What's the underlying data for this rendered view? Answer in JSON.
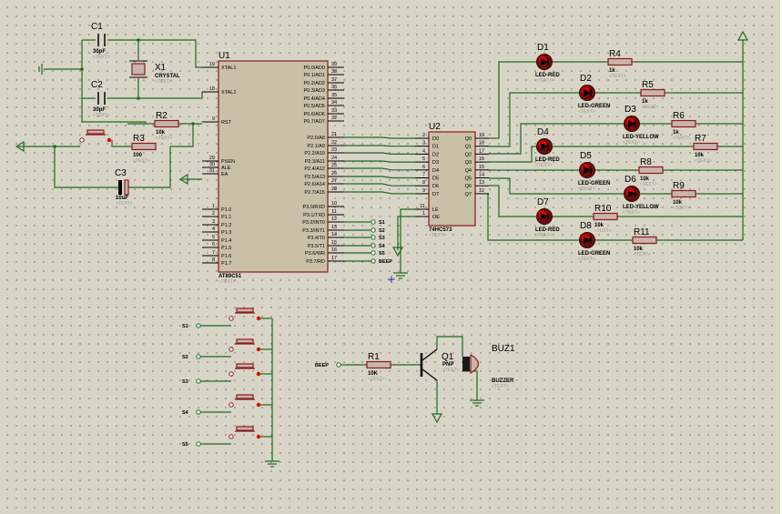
{
  "placeholder": "<TEXT>",
  "u1": {
    "ref": "U1",
    "part": "AT89C51",
    "left_pins": [
      {
        "num": "19",
        "name": "XTAL1"
      },
      {
        "num": "18",
        "name": "XTAL2"
      },
      {
        "num": "9",
        "name": "RST"
      },
      {
        "num": "29",
        "name": "PSEN"
      },
      {
        "num": "30",
        "name": "ALE"
      },
      {
        "num": "31",
        "name": "EA"
      },
      {
        "num": "1",
        "name": "P1.0"
      },
      {
        "num": "2",
        "name": "P1.1"
      },
      {
        "num": "3",
        "name": "P1.2"
      },
      {
        "num": "4",
        "name": "P1.3"
      },
      {
        "num": "5",
        "name": "P1.4"
      },
      {
        "num": "6",
        "name": "P1.5"
      },
      {
        "num": "7",
        "name": "P1.6"
      },
      {
        "num": "8",
        "name": "P1.7"
      }
    ],
    "right_pins": [
      {
        "num": "39",
        "name": "P0.0/AD0"
      },
      {
        "num": "38",
        "name": "P0.1/AD1"
      },
      {
        "num": "37",
        "name": "P0.2/AD2"
      },
      {
        "num": "36",
        "name": "P0.3/AD3"
      },
      {
        "num": "35",
        "name": "P0.4/AD4"
      },
      {
        "num": "34",
        "name": "P0.5/AD5"
      },
      {
        "num": "33",
        "name": "P0.6/AD6"
      },
      {
        "num": "32",
        "name": "P0.7/AD7"
      },
      {
        "num": "21",
        "name": "P2.0/A8"
      },
      {
        "num": "22",
        "name": "P2.1/A9"
      },
      {
        "num": "23",
        "name": "P2.2/A10"
      },
      {
        "num": "24",
        "name": "P2.3/A11"
      },
      {
        "num": "25",
        "name": "P2.4/A12"
      },
      {
        "num": "26",
        "name": "P2.5/A13"
      },
      {
        "num": "27",
        "name": "P2.6/A14"
      },
      {
        "num": "28",
        "name": "P2.7/A15"
      },
      {
        "num": "10",
        "name": "P3.0/RXD"
      },
      {
        "num": "11",
        "name": "P3.1/TXD"
      },
      {
        "num": "12",
        "name": "P3.2/INT0"
      },
      {
        "num": "13",
        "name": "P3.3/INT1"
      },
      {
        "num": "14",
        "name": "P3.4/T0"
      },
      {
        "num": "15",
        "name": "P3.5/T1"
      },
      {
        "num": "16",
        "name": "P3.6/WR"
      },
      {
        "num": "17",
        "name": "P3.7/RD"
      }
    ]
  },
  "u2": {
    "ref": "U2",
    "part": "74HC573",
    "inputs": [
      {
        "num": "2",
        "name": "D0"
      },
      {
        "num": "3",
        "name": "D1"
      },
      {
        "num": "4",
        "name": "D2"
      },
      {
        "num": "5",
        "name": "D3"
      },
      {
        "num": "6",
        "name": "D4"
      },
      {
        "num": "7",
        "name": "D5"
      },
      {
        "num": "8",
        "name": "D6"
      },
      {
        "num": "9",
        "name": "D7"
      }
    ],
    "outputs": [
      {
        "num": "19",
        "name": "Q0"
      },
      {
        "num": "18",
        "name": "Q1"
      },
      {
        "num": "17",
        "name": "Q2"
      },
      {
        "num": "16",
        "name": "Q3"
      },
      {
        "num": "15",
        "name": "Q4"
      },
      {
        "num": "14",
        "name": "Q5"
      },
      {
        "num": "13",
        "name": "Q6"
      },
      {
        "num": "12",
        "name": "Q7"
      }
    ],
    "ctrl": [
      {
        "num": "11",
        "name": "LE"
      },
      {
        "num": "1",
        "name": "OE"
      }
    ]
  },
  "net_labels": [
    "S1",
    "S2",
    "S3",
    "S4",
    "S5",
    "BEEP"
  ],
  "switches": [
    "S1",
    "S2",
    "S3",
    "S4",
    "S5"
  ],
  "crystal": {
    "ref": "X1",
    "value": "CRYSTAL"
  },
  "caps": [
    {
      "ref": "C1",
      "value": "30pF"
    },
    {
      "ref": "C2",
      "value": "30pF"
    },
    {
      "ref": "C3",
      "value": "10uF"
    }
  ],
  "resistors": [
    {
      "ref": "R1",
      "value": "10K"
    },
    {
      "ref": "R2",
      "value": "10k"
    },
    {
      "ref": "R3",
      "value": "100"
    },
    {
      "ref": "R4",
      "value": "1k"
    },
    {
      "ref": "R5",
      "value": "1k"
    },
    {
      "ref": "R6",
      "value": "1k"
    },
    {
      "ref": "R7",
      "value": "10k"
    },
    {
      "ref": "R8",
      "value": "10k"
    },
    {
      "ref": "R9",
      "value": "10k"
    },
    {
      "ref": "R10",
      "value": "10k"
    },
    {
      "ref": "R11",
      "value": "10k"
    }
  ],
  "leds": [
    {
      "ref": "D1",
      "value": "LED-RED",
      "color": "#e00000"
    },
    {
      "ref": "D2",
      "value": "LED-GREEN",
      "color": "#e00000"
    },
    {
      "ref": "D3",
      "value": "LED-YELLOW",
      "color": "#e00000"
    },
    {
      "ref": "D4",
      "value": "LED-RED",
      "color": "#e00000"
    },
    {
      "ref": "D5",
      "value": "LED-GREEN",
      "color": "#e00000"
    },
    {
      "ref": "D6",
      "value": "LED-YELLOW",
      "color": "#e00000"
    },
    {
      "ref": "D7",
      "value": "LED-RED",
      "color": "#e00000"
    },
    {
      "ref": "D8",
      "value": "LED-GREEN",
      "color": "#e00000"
    }
  ],
  "transistor": {
    "ref": "Q1",
    "value": "PNP"
  },
  "buzzer": {
    "ref": "BUZ1",
    "value": "BUZZER"
  },
  "colors": {
    "wire": "#1e6b1e",
    "component": "#8b1a1a",
    "body": "#c9b4ad",
    "sheet": "#d8d4c6"
  }
}
